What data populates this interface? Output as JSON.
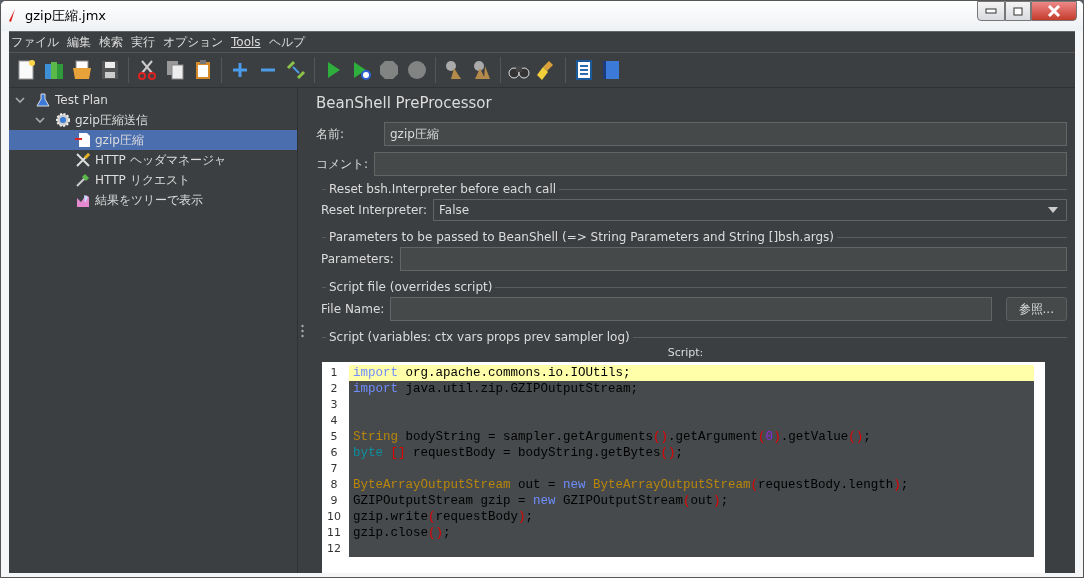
{
  "window": {
    "title": "gzip圧縮.jmx"
  },
  "menu": [
    {
      "label": "ファイル"
    },
    {
      "label": "編集"
    },
    {
      "label": "検索"
    },
    {
      "label": "実行"
    },
    {
      "label": "オプション"
    },
    {
      "label": "Tools",
      "underline": true
    },
    {
      "label": "ヘルプ"
    }
  ],
  "toolbar": [
    {
      "kind": "new"
    },
    {
      "kind": "templates"
    },
    {
      "kind": "open"
    },
    {
      "kind": "save"
    },
    {
      "kind": "sep"
    },
    {
      "kind": "cut"
    },
    {
      "kind": "copy"
    },
    {
      "kind": "paste"
    },
    {
      "kind": "sep"
    },
    {
      "kind": "add"
    },
    {
      "kind": "remove"
    },
    {
      "kind": "toggle"
    },
    {
      "kind": "sep"
    },
    {
      "kind": "start"
    },
    {
      "kind": "start-no-timers"
    },
    {
      "kind": "stop",
      "disabled": true
    },
    {
      "kind": "shutdown",
      "disabled": true
    },
    {
      "kind": "sep"
    },
    {
      "kind": "clear"
    },
    {
      "kind": "clear-all"
    },
    {
      "kind": "sep"
    },
    {
      "kind": "search"
    },
    {
      "kind": "reset-search"
    },
    {
      "kind": "sep"
    },
    {
      "kind": "function-helper"
    },
    {
      "kind": "help"
    }
  ],
  "tree": [
    {
      "label": "Test Plan",
      "kind": "flask",
      "expanded": true,
      "selected": false,
      "children": [
        {
          "label": "gzip圧縮送信",
          "kind": "gear",
          "expanded": true,
          "selected": false,
          "children": [
            {
              "label": "gzip圧縮",
              "kind": "preprocessor",
              "selected": true
            },
            {
              "label": "HTTP ヘッダマネージャ",
              "kind": "tools",
              "selected": false
            },
            {
              "label": "HTTP リクエスト",
              "kind": "dropper",
              "selected": false
            },
            {
              "label": "結果をツリーで表示",
              "kind": "chart",
              "selected": false
            }
          ]
        }
      ]
    }
  ],
  "panel": {
    "title": "BeanShell PreProcessor",
    "name_label": "名前:",
    "name_value": "gzip圧縮",
    "comment_label": "コメント:",
    "reset_section": "Reset bsh.Interpreter before each call",
    "reset_label": "Reset Interpreter:",
    "reset_value": "False",
    "params_section": "Parameters to be passed to BeanShell (=> String Parameters and String []bsh.args)",
    "params_label": "Parameters:",
    "file_section": "Script file (overrides script)",
    "file_label": "File Name:",
    "browse_button": "参照...",
    "script_section": "Script (variables: ctx vars props prev sampler log)",
    "script_caption": "Script:"
  },
  "script": {
    "lines": [
      {
        "number": "1",
        "highlighted": true,
        "tokens": [
          {
            "kind": "keyword",
            "text": "import"
          },
          {
            "kind": "plain",
            "text": " org.apache.commons.io.IOUtils;"
          }
        ]
      },
      {
        "number": "2",
        "highlighted": false,
        "tokens": [
          {
            "kind": "keyword",
            "text": "import"
          },
          {
            "kind": "plain",
            "text": " java.util.zip.GZIPOutputStream;"
          }
        ]
      },
      {
        "number": "3",
        "highlighted": false
      },
      {
        "number": "4",
        "highlighted": false
      },
      {
        "number": "5",
        "highlighted": false,
        "tokens": [
          {
            "kind": "type",
            "text": "String"
          },
          {
            "kind": "plain",
            "text": " bodyString = sampler.getArguments"
          },
          {
            "kind": "paren",
            "text": "()"
          },
          {
            "kind": "plain",
            "text": ".getArgument"
          },
          {
            "kind": "paren",
            "text": "("
          },
          {
            "kind": "number",
            "text": "0"
          },
          {
            "kind": "paren",
            "text": ")"
          },
          {
            "kind": "plain",
            "text": ".getValue"
          },
          {
            "kind": "paren",
            "text": "()"
          },
          {
            "kind": "plain",
            "text": ";"
          }
        ]
      },
      {
        "number": "6",
        "highlighted": false,
        "tokens": [
          {
            "kind": "primitive",
            "text": "byte "
          },
          {
            "kind": "paren",
            "text": "[]"
          },
          {
            "kind": "plain",
            "text": " requestBody = bodyString.getBytes"
          },
          {
            "kind": "paren",
            "text": "()"
          },
          {
            "kind": "plain",
            "text": ";"
          }
        ]
      },
      {
        "number": "7",
        "highlighted": false
      },
      {
        "number": "8",
        "highlighted": false,
        "tokens": [
          {
            "kind": "type",
            "text": "ByteArrayOutputStream"
          },
          {
            "kind": "plain",
            "text": " out = "
          },
          {
            "kind": "keyword",
            "text": "new "
          },
          {
            "kind": "type",
            "text": "ByteArrayOutputStream"
          },
          {
            "kind": "paren",
            "text": "("
          },
          {
            "kind": "plain",
            "text": "requestBody.length"
          },
          {
            "kind": "paren",
            "text": ")"
          },
          {
            "kind": "plain",
            "text": ";"
          }
        ]
      },
      {
        "number": "9",
        "highlighted": false,
        "tokens": [
          {
            "kind": "plain",
            "text": "GZIPOutputStream gzip = "
          },
          {
            "kind": "keyword",
            "text": "new"
          },
          {
            "kind": "plain",
            "text": " GZIPOutputStream"
          },
          {
            "kind": "paren",
            "text": "("
          },
          {
            "kind": "plain",
            "text": "out"
          },
          {
            "kind": "paren",
            "text": ")"
          },
          {
            "kind": "plain",
            "text": ";"
          }
        ]
      },
      {
        "number": "10",
        "highlighted": false,
        "tokens": [
          {
            "kind": "plain",
            "text": "gzip.write"
          },
          {
            "kind": "paren",
            "text": "("
          },
          {
            "kind": "plain",
            "text": "requestBody"
          },
          {
            "kind": "paren",
            "text": ")"
          },
          {
            "kind": "plain",
            "text": ";"
          }
        ]
      },
      {
        "number": "11",
        "highlighted": false,
        "tokens": [
          {
            "kind": "plain",
            "text": "gzip.close"
          },
          {
            "kind": "paren",
            "text": "()"
          },
          {
            "kind": "plain",
            "text": ";"
          }
        ]
      },
      {
        "number": "12",
        "highlighted": false
      }
    ]
  }
}
